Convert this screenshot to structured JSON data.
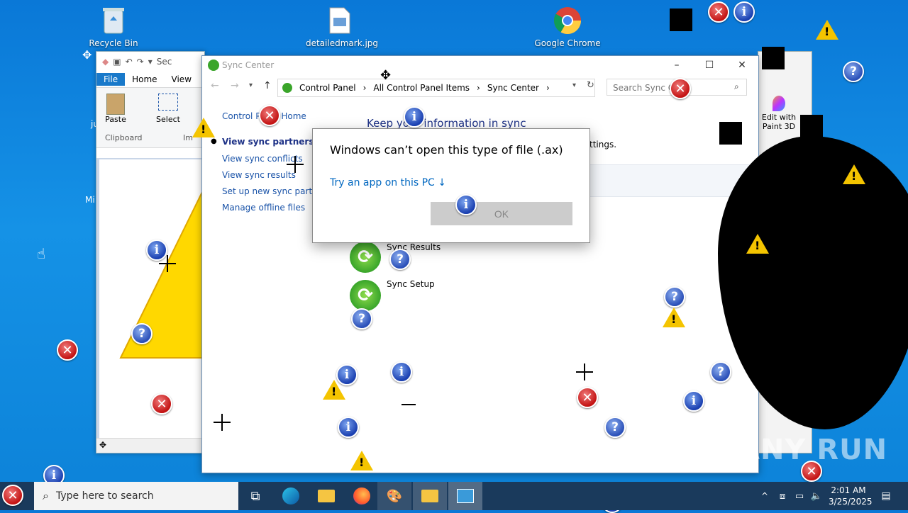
{
  "desktop": {
    "icons": [
      {
        "label": "Recycle Bin"
      },
      {
        "label": "detailedmark.jpg"
      },
      {
        "label": "Google Chrome"
      },
      {
        "label": "Mi"
      },
      {
        "label": "ju"
      }
    ]
  },
  "paint": {
    "quick_access_partial": "Sec",
    "tabs": [
      "File",
      "Home",
      "View"
    ],
    "tools": {
      "paste": "Paste",
      "select": "Select"
    },
    "groups": {
      "clipboard": "Clipboard",
      "image_partial": "Im"
    }
  },
  "paint3d": {
    "label": "Edit with Paint 3D"
  },
  "sync_center": {
    "title": "Sync Center",
    "breadcrumbs": [
      "Control Panel",
      "All Control Panel Items",
      "Sync Center"
    ],
    "search_placeholder": "Search Sync Ce",
    "nav": {
      "home": "Control Panel Home",
      "partnerships": "View sync partnerships",
      "conflicts": "View sync conflicts",
      "results": "View sync results",
      "setup": "Set up new sync partner",
      "offline": "Manage offline files"
    },
    "heading": "Keep your information in sync",
    "settings_partial": "ttings.",
    "items": [
      {
        "label": "Sync Results"
      },
      {
        "label": "Sync Setup"
      }
    ]
  },
  "dialog": {
    "message": "Windows can’t open this type of file (.ax)",
    "link": "Try an app on this PC ↓",
    "ok": "OK"
  },
  "taskbar": {
    "search_placeholder": "Type here to search",
    "time": "2:01 AM",
    "date": "3/25/2025"
  },
  "watermark": "ANY RUN",
  "colors": {
    "desktop": "#0a78d7",
    "taskbar": "#1a3a5c",
    "link": "#0067c0",
    "heading": "#1e3287"
  }
}
